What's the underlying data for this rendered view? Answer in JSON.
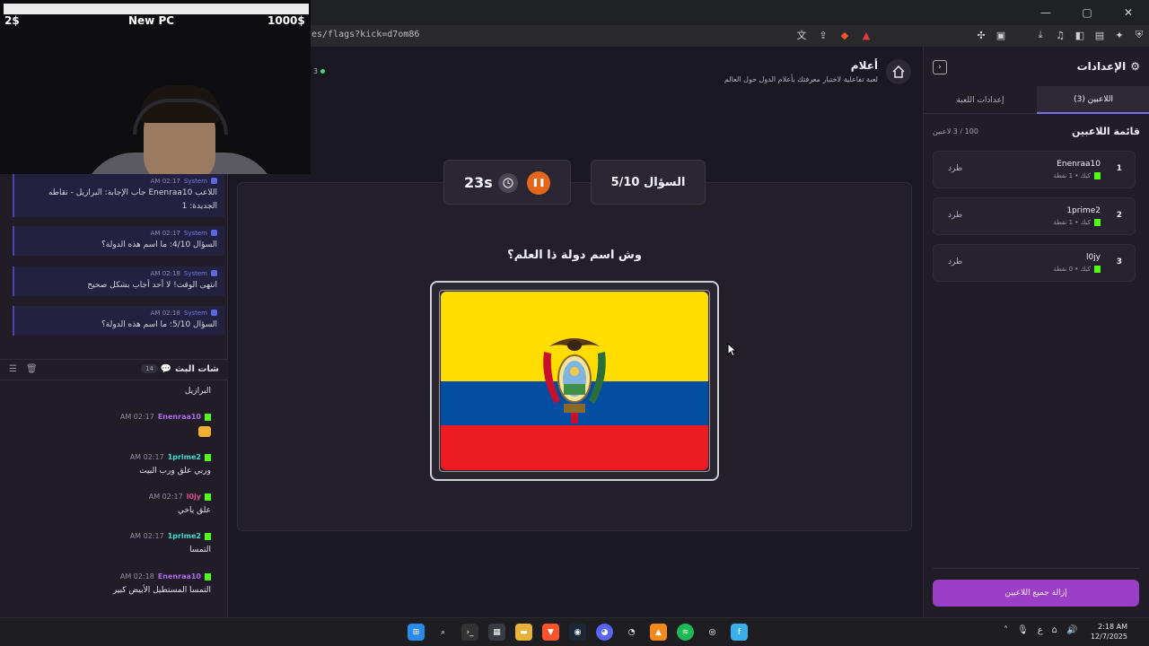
{
  "browser": {
    "url": "es/flags?kick=d7om86",
    "window_controls": [
      "—",
      "▢",
      "✕"
    ]
  },
  "webcam": {
    "left_label": "2$",
    "center_label": "New PC",
    "right_label": "1000$"
  },
  "status": {
    "number": "3"
  },
  "system_messages": [
    {
      "author": "System",
      "time": "02:17 AM",
      "text": "اللاعب Enenraa10 جاب الإجابة: البرازيل - نقاطه الجديدة: 1"
    },
    {
      "author": "System",
      "time": "02:17 AM",
      "text": "السؤال 4/10: ما اسم هذه الدولة؟"
    },
    {
      "author": "System",
      "time": "02:18 AM",
      "text": "انتهى الوقت! لا أحد أجاب بشكل صحيح"
    },
    {
      "author": "System",
      "time": "02:18 AM",
      "text": "السؤال 5/10: ما اسم هذه الدولة؟"
    }
  ],
  "chat": {
    "title": "شات البث",
    "count": "14",
    "messages": [
      {
        "user": "",
        "time": "",
        "text": "البرازيل",
        "color": ""
      },
      {
        "user": "Enenraa10",
        "time": "02:17 AM",
        "text": "",
        "emoji": true,
        "color": "#b06af0"
      },
      {
        "user": "1prime2",
        "time": "02:17 AM",
        "text": "وربي علق ورب البيت",
        "color": "#3ddcd0"
      },
      {
        "user": "l0jy",
        "time": "02:17 AM",
        "text": "علق ياخي",
        "color": "#e05090"
      },
      {
        "user": "1prime2",
        "time": "02:17 AM",
        "text": "التمسا",
        "color": "#3ddcd0"
      },
      {
        "user": "Enenraa10",
        "time": "02:18 AM",
        "text": "التمسا المستطيل الأبيض كبير",
        "color": "#b06af0"
      }
    ]
  },
  "game": {
    "title": "أعلام",
    "subtitle": "لعبة تفاعلية لاختبار معرفتك بأعلام الدول حول العالم",
    "timer": "23s",
    "question_counter": "السؤال 5/10",
    "question": "وش اسم دولة ذا العلم؟",
    "flag_colors": {
      "yellow": "#ffdd00",
      "blue": "#034ea2",
      "red": "#ed1c24"
    }
  },
  "settings": {
    "title": "الإعدادات",
    "tabs": [
      "اللاعبين (3)",
      "إعدادات اللعبة"
    ],
    "players_title": "قائمة اللاعبين",
    "players_count": "100 / 3 لاعبين",
    "players": [
      {
        "rank": "1",
        "name": "Enenraa10",
        "info": "كيك • 1 نقطة",
        "kick": "طرد"
      },
      {
        "rank": "2",
        "name": "1prime2",
        "info": "كيك • 1 نقطة",
        "kick": "طرد"
      },
      {
        "rank": "3",
        "name": "l0jy",
        "info": "كيك • 0 نقطة",
        "kick": "طرد"
      }
    ],
    "remove_all": "إزالة جميع اللاعبين"
  },
  "taskbar": {
    "time": "2:18 AM",
    "date": "12/7/2025",
    "lang": "ع",
    "icons": [
      "windows-start",
      "search",
      "terminal",
      "store",
      "files",
      "brave",
      "steam",
      "discord",
      "speed",
      "vlc-like",
      "spotify",
      "chrome",
      "app"
    ]
  }
}
